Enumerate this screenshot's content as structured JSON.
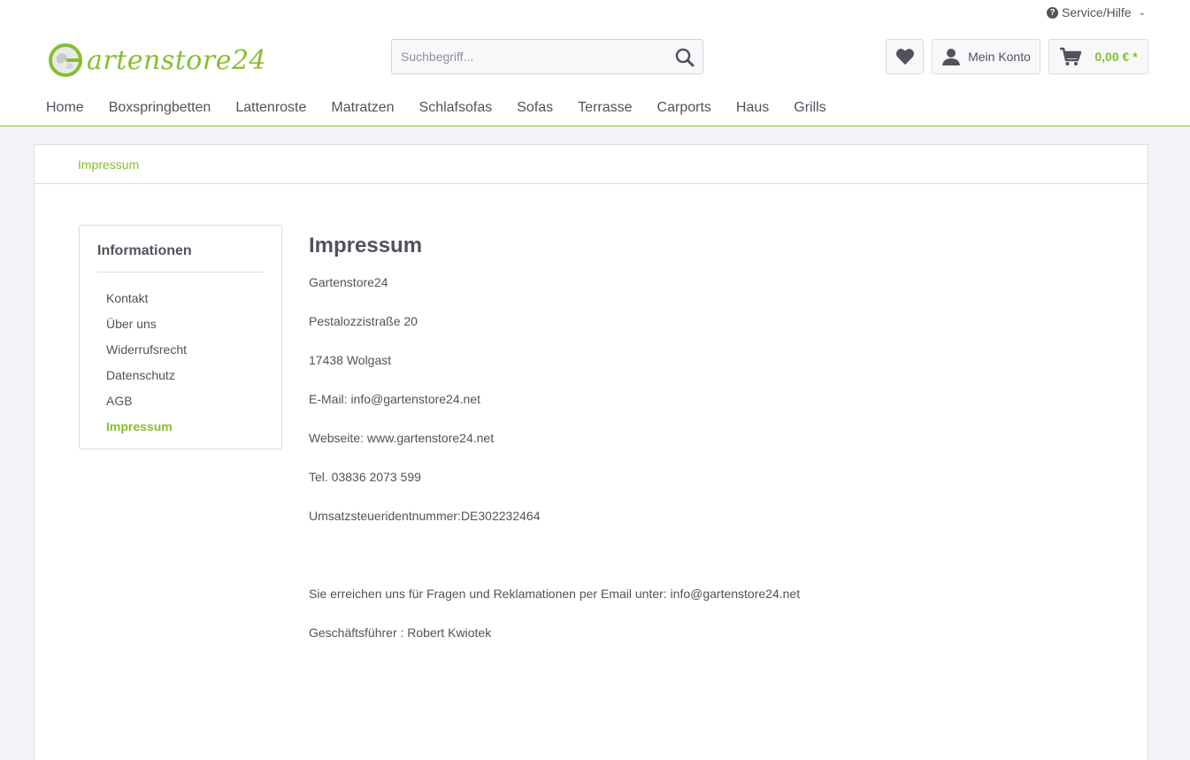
{
  "header": {
    "service_label": "Service/Hilfe",
    "logo_text": "artenstore24",
    "logo_letter": "G",
    "search_placeholder": "Suchbegriff...",
    "account_label": "Mein Konto",
    "cart_price": "0,00 € *"
  },
  "nav": {
    "items": [
      "Home",
      "Boxspringbetten",
      "Lattenroste",
      "Matratzen",
      "Schlafsofas",
      "Sofas",
      "Terrasse",
      "Carports",
      "Haus",
      "Grills"
    ]
  },
  "breadcrumb": {
    "current": "Impressum"
  },
  "sidebar": {
    "title": "Informationen",
    "items": [
      "Kontakt",
      "Über uns",
      "Widerrufsrecht",
      "Datenschutz",
      "AGB",
      "Impressum"
    ]
  },
  "main": {
    "title": "Impressum",
    "lines": [
      "Gartenstore24",
      "Pestalozzistraße 20",
      "17438 Wolgast",
      "E-Mail: info@gartenstore24.net",
      "Webseite: www.gartenstore24.net",
      "Tel. 03836 2073 599",
      "Umsatzsteueridentnummer:DE302232464",
      "Sie erreichen uns für Fragen und Reklamationen per Email unter: info@gartenstore24.net",
      "Geschäftsführer : Robert Kwiotek"
    ]
  },
  "colors": {
    "accent": "#85bf30",
    "text": "#52525e",
    "border": "#dadae5",
    "background": "#f4f4f8"
  }
}
